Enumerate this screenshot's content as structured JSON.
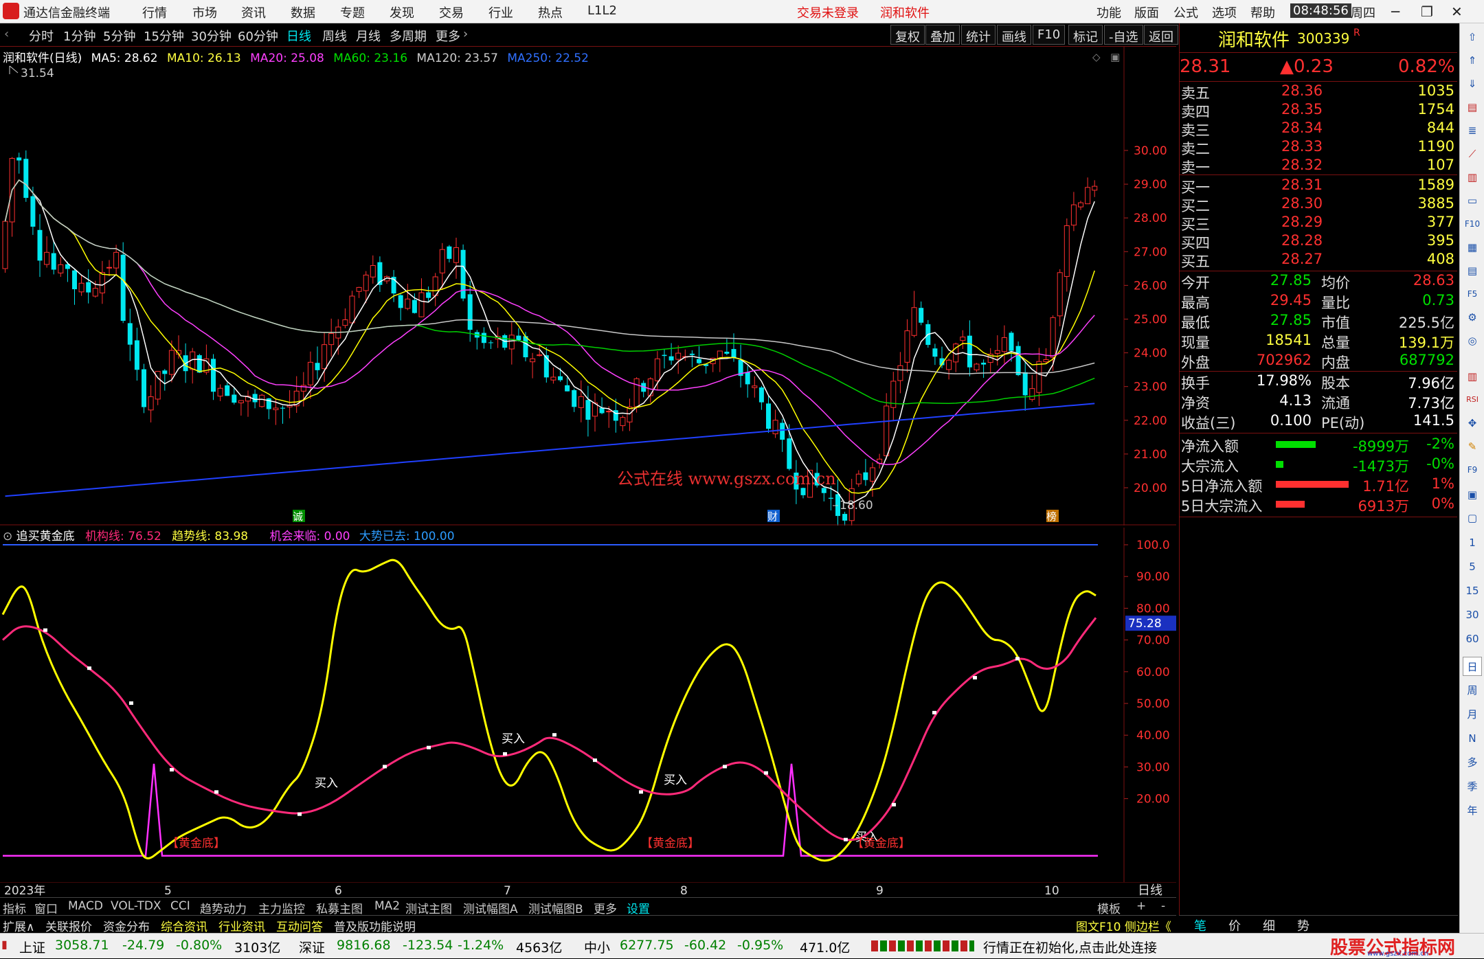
{
  "app": {
    "title": "通达信金融终端",
    "menus": [
      "行情",
      "市场",
      "资讯",
      "数据",
      "专题",
      "发现",
      "交易",
      "行业",
      "热点",
      "L1L2"
    ],
    "login_status": "交易未登录",
    "stock_name": "润和软件",
    "right_menus": [
      "功能",
      "版面",
      "公式",
      "选项",
      "帮助"
    ],
    "time": "08:48:56",
    "weekday": "周四"
  },
  "periods": [
    "分时",
    "1分钟",
    "5分钟",
    "15分钟",
    "30分钟",
    "60分钟",
    "日线",
    "周线",
    "月线",
    "多周期",
    "更多"
  ],
  "toolbar": [
    "复权",
    "叠加",
    "统计",
    "画线",
    "F10",
    "标记",
    "-自选",
    "返回"
  ],
  "ma_line": {
    "title": "润和软件(日线)",
    "ma5": "MA5: 28.62",
    "ma10": "MA10: 26.13",
    "ma20": "MA20: 25.08",
    "ma60": "MA60: 23.16",
    "ma120": "MA120: 23.57",
    "ma250": "MA250: 22.52"
  },
  "chart": {
    "high_label": "31.54",
    "low_label": "18.60",
    "watermark": "公式在线  www.gszx.com.cn",
    "markers": [
      "诚",
      "财",
      "榜"
    ],
    "price_ticks": [
      "30.00",
      "29.00",
      "28.00",
      "27.00",
      "26.00",
      "25.00",
      "24.00",
      "23.00",
      "22.00",
      "21.00",
      "20.00"
    ],
    "ind_ticks": [
      "100.0",
      "90.00",
      "80.00",
      "70.00",
      "60.00",
      "50.00",
      "40.00",
      "30.00",
      "20.00"
    ],
    "current_ind_value": "75.28",
    "x_labels": [
      "2023年",
      "5",
      "6",
      "7",
      "8",
      "9",
      "10"
    ],
    "period_tag": "日线"
  },
  "indicator": {
    "name": "追买黄金底",
    "jigou": "机构线: 76.52",
    "qushi": "趋势线: 83.98",
    "jihui": "机会来临: 0.00",
    "dashi": "大势已去: 100.00",
    "buy_label": "买入",
    "gold_label": "【黄金底】"
  },
  "bottom_tabs": [
    "指标",
    "窗口",
    "MACD",
    "VOL-TDX",
    "CCI",
    "趋势动力",
    "主力监控",
    "私募主图",
    "MA2",
    "测试主图",
    "测试幅图A",
    "测试幅图B",
    "更多",
    "设置"
  ],
  "bottom_right": [
    "模板",
    "+",
    "-"
  ],
  "info_tabs": [
    "扩展∧",
    "关联报价",
    "资金分布",
    "综合资讯",
    "行业资讯",
    "互动问答",
    "普及版功能说明"
  ],
  "info_right": "图文F10 侧边栏《",
  "quote": {
    "name": "润和软件",
    "code": "300339",
    "badge": "R",
    "price": "28.31",
    "change": "▲0.23",
    "pct": "0.82%",
    "asks": [
      {
        "label": "卖五",
        "price": "28.36",
        "vol": "1035"
      },
      {
        "label": "卖四",
        "price": "28.35",
        "vol": "1754"
      },
      {
        "label": "卖三",
        "price": "28.34",
        "vol": "844"
      },
      {
        "label": "卖二",
        "price": "28.33",
        "vol": "1190"
      },
      {
        "label": "卖一",
        "price": "28.32",
        "vol": "107"
      }
    ],
    "bids": [
      {
        "label": "买一",
        "price": "28.31",
        "vol": "1589"
      },
      {
        "label": "买二",
        "price": "28.30",
        "vol": "3885"
      },
      {
        "label": "买三",
        "price": "28.29",
        "vol": "377"
      },
      {
        "label": "买四",
        "price": "28.28",
        "vol": "395"
      },
      {
        "label": "买五",
        "price": "28.27",
        "vol": "408"
      }
    ],
    "stats": [
      {
        "l1": "今开",
        "v1": "27.85",
        "l2": "均价",
        "v2": "28.63"
      },
      {
        "l1": "最高",
        "v1": "29.45",
        "l2": "量比",
        "v2": "0.73"
      },
      {
        "l1": "最低",
        "v1": "27.85",
        "l2": "市值",
        "v2": "225.5亿"
      },
      {
        "l1": "现量",
        "v1": "18541",
        "l2": "总量",
        "v2": "139.1万"
      },
      {
        "l1": "外盘",
        "v1": "702962",
        "l2": "内盘",
        "v2": "687792"
      }
    ],
    "stats2": [
      {
        "l1": "换手",
        "v1": "17.98%",
        "l2": "股本",
        "v2": "7.96亿"
      },
      {
        "l1": "净资",
        "v1": "4.13",
        "l2": "流通",
        "v2": "7.73亿"
      },
      {
        "l1": "收益(三)",
        "v1": "0.100",
        "l2": "PE(动)",
        "v2": "141.5"
      }
    ],
    "flows": [
      {
        "label": "净流入额",
        "value": "-8999万",
        "pct": "-2%",
        "bar": 0.55
      },
      {
        "label": "大宗流入",
        "value": "-1473万",
        "pct": "-0%",
        "bar": 0.1
      },
      {
        "label": "5日净流入额",
        "value": "1.71亿",
        "pct": "1%",
        "bar": 1.0
      },
      {
        "label": "5日大宗流入",
        "value": "6913万",
        "pct": "0%",
        "bar": 0.4
      }
    ],
    "tabs": [
      "笔",
      "价",
      "细",
      "势"
    ]
  },
  "status": {
    "sh_label": "上证",
    "sh_value": "3058.71",
    "sh_chg": "-24.79",
    "sh_pct": "-0.80%",
    "sh_amt": "3103亿",
    "sz_label": "深证",
    "sz_value": "9816.68",
    "sz_chg": "-123.54",
    "sz_pct": "-1.24%",
    "sz_amt": "4563亿",
    "zx_label": "中小",
    "zx_value": "6277.75",
    "zx_chg": "-60.42",
    "zx_pct": "-0.95%",
    "zx_amt": "471.0亿",
    "message": "行情正在初始化,点击此处连接",
    "brand": "股票公式指标网",
    "brand_url": "www.gszx.com.cn"
  },
  "side_icons": [
    "1",
    "5",
    "15",
    "30",
    "60",
    "日",
    "周",
    "月",
    "N",
    "多",
    "季",
    "年"
  ],
  "colors": {
    "up": "#ff3030",
    "down": "#00e8f0",
    "ma5": "#ffffff",
    "ma10": "#ffff00",
    "ma20": "#ff40ff",
    "ma60": "#00d000",
    "ma120": "#c8c8c8",
    "ma250": "#2040ff",
    "jigou": "#ff2a7a",
    "qushi": "#ffff00",
    "jihui": "#ff30ff",
    "dashi": "#2c5cff"
  }
}
